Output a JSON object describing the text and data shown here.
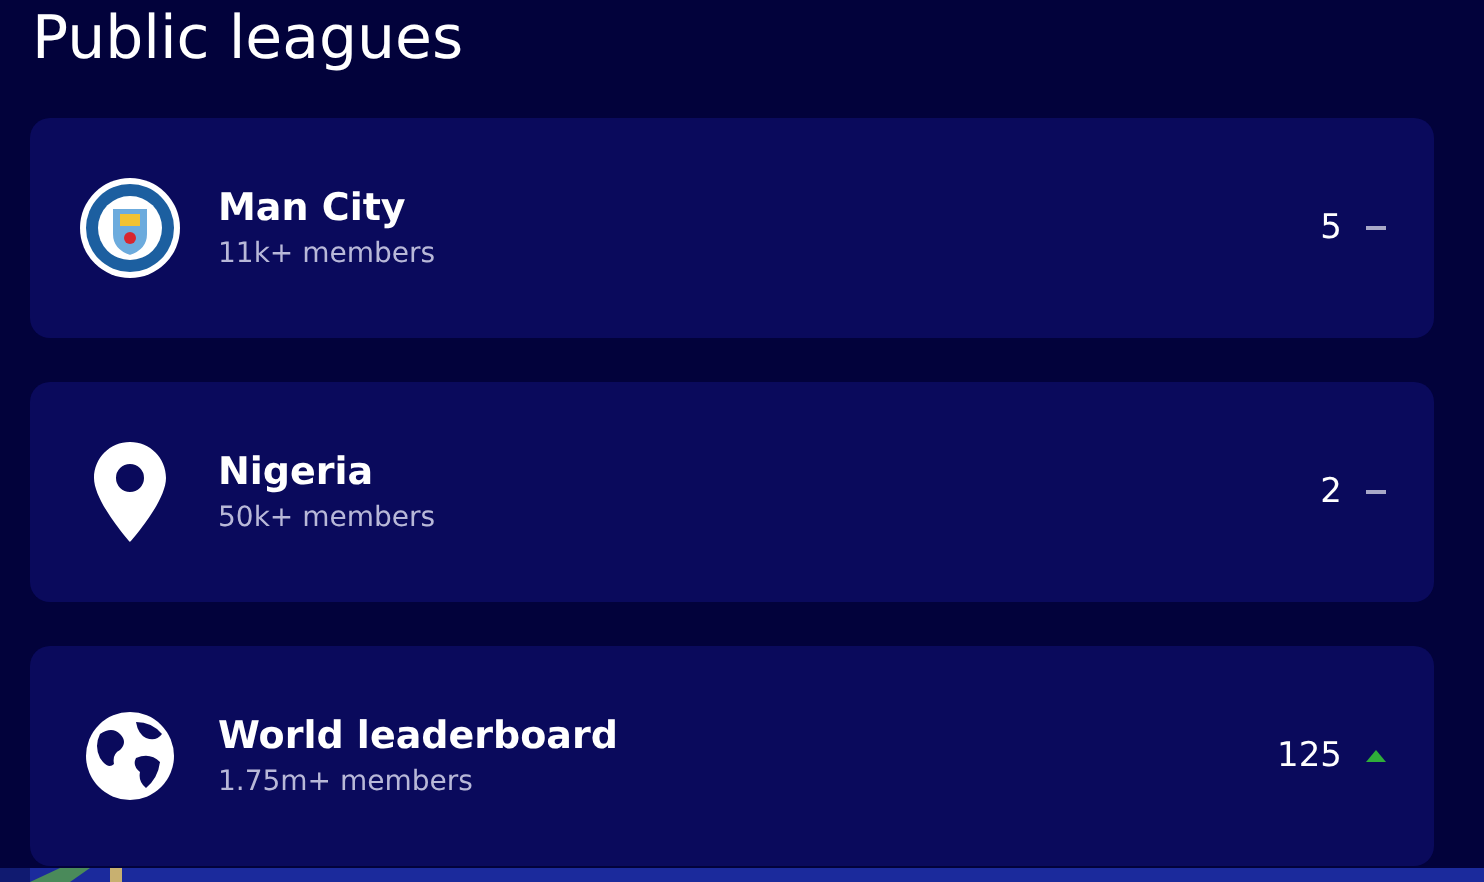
{
  "title": "Public leagues",
  "leagues": [
    {
      "kind": "crest",
      "name": "Man City",
      "members": "11k+ members",
      "rank": "5",
      "rank_up": false
    },
    {
      "kind": "pin",
      "name": "Nigeria",
      "members": "50k+ members",
      "rank": "2",
      "rank_up": false
    },
    {
      "kind": "globe",
      "name": "World leaderboard",
      "members": "1.75m+ members",
      "rank": "125",
      "rank_up": true
    }
  ]
}
